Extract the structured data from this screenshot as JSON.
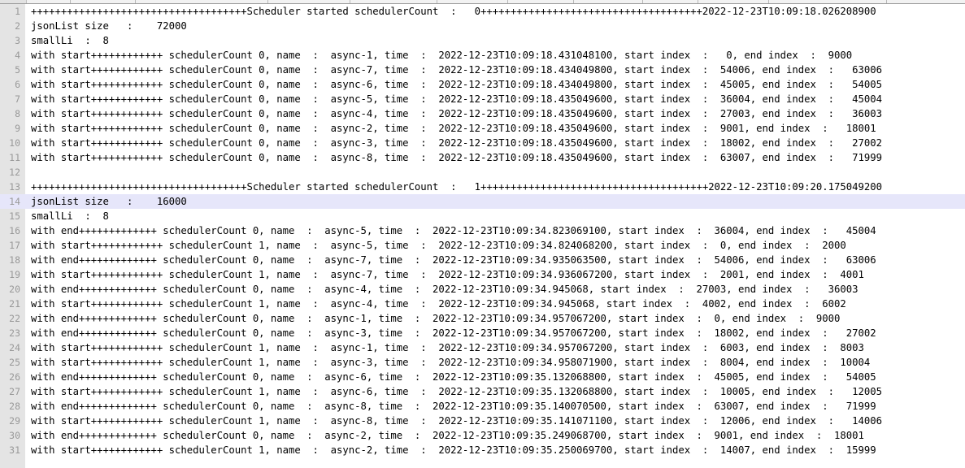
{
  "app": {
    "type": "text-editor-log-view",
    "gutter_color": "#e4e4e4",
    "gutter_number_color": "#999999",
    "background_color": "#ffffff",
    "text_color": "#000000",
    "highlight_color": "#e6e6fa",
    "highlighted_line_number": 14
  },
  "lines": [
    {
      "num": "1",
      "text": "++++++++++++++++++++++++++++++++++++Scheduler started schedulerCount  :   0+++++++++++++++++++++++++++++++++++++2022-12-23T10:09:18.026208900",
      "highlighted": false
    },
    {
      "num": "2",
      "text": "jsonList size   :    72000",
      "highlighted": false
    },
    {
      "num": "3",
      "text": "smallLi  :  8",
      "highlighted": false
    },
    {
      "num": "4",
      "text": "with start++++++++++++ schedulerCount 0, name  :  async-1, time  :  2022-12-23T10:09:18.431048100, start index  :   0, end index  :  9000",
      "highlighted": false
    },
    {
      "num": "5",
      "text": "with start++++++++++++ schedulerCount 0, name  :  async-7, time  :  2022-12-23T10:09:18.434049800, start index  :  54006, end index  :   63006",
      "highlighted": false
    },
    {
      "num": "6",
      "text": "with start++++++++++++ schedulerCount 0, name  :  async-6, time  :  2022-12-23T10:09:18.434049800, start index  :  45005, end index  :   54005",
      "highlighted": false
    },
    {
      "num": "7",
      "text": "with start++++++++++++ schedulerCount 0, name  :  async-5, time  :  2022-12-23T10:09:18.435049600, start index  :  36004, end index  :   45004",
      "highlighted": false
    },
    {
      "num": "8",
      "text": "with start++++++++++++ schedulerCount 0, name  :  async-4, time  :  2022-12-23T10:09:18.435049600, start index  :  27003, end index  :   36003",
      "highlighted": false
    },
    {
      "num": "9",
      "text": "with start++++++++++++ schedulerCount 0, name  :  async-2, time  :  2022-12-23T10:09:18.435049600, start index  :  9001, end index  :   18001",
      "highlighted": false
    },
    {
      "num": "10",
      "text": "with start++++++++++++ schedulerCount 0, name  :  async-3, time  :  2022-12-23T10:09:18.435049600, start index  :  18002, end index  :   27002",
      "highlighted": false
    },
    {
      "num": "11",
      "text": "with start++++++++++++ schedulerCount 0, name  :  async-8, time  :  2022-12-23T10:09:18.435049600, start index  :  63007, end index  :   71999",
      "highlighted": false
    },
    {
      "num": "12",
      "text": "",
      "highlighted": false
    },
    {
      "num": "13",
      "text": "++++++++++++++++++++++++++++++++++++Scheduler started schedulerCount  :   1++++++++++++++++++++++++++++++++++++++2022-12-23T10:09:20.175049200",
      "highlighted": false
    },
    {
      "num": "14",
      "text": "jsonList size   :    16000",
      "highlighted": true
    },
    {
      "num": "15",
      "text": "smallLi  :  8",
      "highlighted": false
    },
    {
      "num": "16",
      "text": "with end+++++++++++++ schedulerCount 0, name  :  async-5, time  :  2022-12-23T10:09:34.823069100, start index  :  36004, end index  :   45004",
      "highlighted": false
    },
    {
      "num": "17",
      "text": "with start++++++++++++ schedulerCount 1, name  :  async-5, time  :  2022-12-23T10:09:34.824068200, start index  :  0, end index  :  2000",
      "highlighted": false
    },
    {
      "num": "18",
      "text": "with end+++++++++++++ schedulerCount 0, name  :  async-7, time  :  2022-12-23T10:09:34.935063500, start index  :  54006, end index  :   63006",
      "highlighted": false
    },
    {
      "num": "19",
      "text": "with start++++++++++++ schedulerCount 1, name  :  async-7, time  :  2022-12-23T10:09:34.936067200, start index  :  2001, end index  :  4001",
      "highlighted": false
    },
    {
      "num": "20",
      "text": "with end+++++++++++++ schedulerCount 0, name  :  async-4, time  :  2022-12-23T10:09:34.945068, start index  :  27003, end index  :   36003",
      "highlighted": false
    },
    {
      "num": "21",
      "text": "with start++++++++++++ schedulerCount 1, name  :  async-4, time  :  2022-12-23T10:09:34.945068, start index  :  4002, end index  :  6002",
      "highlighted": false
    },
    {
      "num": "22",
      "text": "with end+++++++++++++ schedulerCount 0, name  :  async-1, time  :  2022-12-23T10:09:34.957067200, start index  :  0, end index  :  9000",
      "highlighted": false
    },
    {
      "num": "23",
      "text": "with end+++++++++++++ schedulerCount 0, name  :  async-3, time  :  2022-12-23T10:09:34.957067200, start index  :  18002, end index  :   27002",
      "highlighted": false
    },
    {
      "num": "24",
      "text": "with start++++++++++++ schedulerCount 1, name  :  async-1, time  :  2022-12-23T10:09:34.957067200, start index  :  6003, end index  :  8003",
      "highlighted": false
    },
    {
      "num": "25",
      "text": "with start++++++++++++ schedulerCount 1, name  :  async-3, time  :  2022-12-23T10:09:34.958071900, start index  :  8004, end index  :  10004",
      "highlighted": false
    },
    {
      "num": "26",
      "text": "with end+++++++++++++ schedulerCount 0, name  :  async-6, time  :  2022-12-23T10:09:35.132068800, start index  :  45005, end index  :   54005",
      "highlighted": false
    },
    {
      "num": "27",
      "text": "with start++++++++++++ schedulerCount 1, name  :  async-6, time  :  2022-12-23T10:09:35.132068800, start index  :  10005, end index  :   12005",
      "highlighted": false
    },
    {
      "num": "28",
      "text": "with end+++++++++++++ schedulerCount 0, name  :  async-8, time  :  2022-12-23T10:09:35.140070500, start index  :  63007, end index  :   71999",
      "highlighted": false
    },
    {
      "num": "29",
      "text": "with start++++++++++++ schedulerCount 1, name  :  async-8, time  :  2022-12-23T10:09:35.141071100, start index  :  12006, end index  :   14006",
      "highlighted": false
    },
    {
      "num": "30",
      "text": "with end+++++++++++++ schedulerCount 0, name  :  async-2, time  :  2022-12-23T10:09:35.249068700, start index  :  9001, end index  :  18001",
      "highlighted": false
    },
    {
      "num": "31",
      "text": "with start++++++++++++ schedulerCount 1, name  :  async-2, time  :  2022-12-23T10:09:35.250069700, start index  :  14007, end index  :  15999",
      "highlighted": false
    }
  ]
}
